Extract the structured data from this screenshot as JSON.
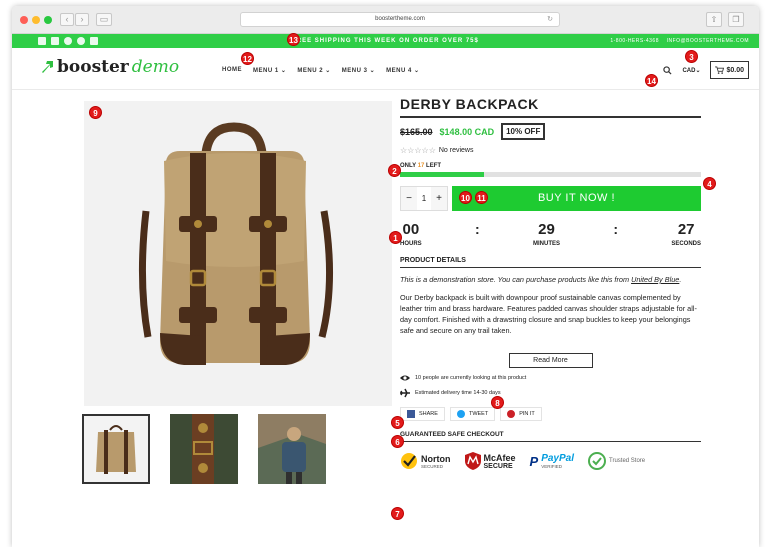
{
  "browser": {
    "url": "boostertheme.com",
    "colors": {
      "close": "#fe5f57",
      "minimize": "#febc2e",
      "zoom": "#28c840"
    }
  },
  "promo_bar": {
    "text": "FREE SHIPPING THIS WEEK ON ORDER OVER 75$",
    "phone": "1-800-HERS-4368",
    "email": "INFO@BOOSTERTHEME.COM",
    "accent": "#2fce47"
  },
  "header": {
    "logo_word1": "booster",
    "logo_word2": "demo",
    "menu": [
      "HOME",
      "MENU 1",
      "MENU 2",
      "MENU 3",
      "MENU 4"
    ],
    "currency": "CAD",
    "cart_total": "$0.00"
  },
  "product": {
    "title": "DERBY BACKPACK",
    "old_price": "$165.00",
    "new_price": "$148.00 CAD",
    "discount": "10% OFF",
    "reviews": "No reviews",
    "stock_prefix": "ONLY",
    "stock_count": "17",
    "stock_suffix": "LEFT",
    "stock_fraction": 0.28,
    "quantity": "1",
    "buy_label": "BUY IT NOW !",
    "countdown": [
      {
        "value": "00",
        "label": "HOURS"
      },
      {
        "value": "29",
        "label": "MINUTES"
      },
      {
        "value": "27",
        "label": "SECONDS"
      }
    ],
    "details_heading": "PRODUCT DETAILS",
    "demo_note": "This is a demonstration store. You can purchase products like this from",
    "demo_link": "United By Blue",
    "description": "Our Derby backpack is built with downpour proof sustainable canvas complemented by leather trim and brass hardware. Features padded canvas shoulder straps adjustable for all-day comfort. Finished with a drawstring closure and snap buckles to keep your belongings safe and secure on any trail taken.",
    "read_more": "Read More",
    "viewers": "10 people are currently looking at this product",
    "delivery": "Estimated delivery time 14-30 days",
    "share": [
      "SHARE",
      "TWEET",
      "PIN IT"
    ],
    "safe_heading": "GUARANTEED SAFE CHECKOUT",
    "trust": {
      "norton": "Norton",
      "norton_sub": "SECURED",
      "mcafee": "McAfee",
      "mcafee_sub": "SECURE",
      "paypal": "PayPal",
      "paypal_sub": "VERIFIED",
      "trusted": "Trusted Store"
    }
  },
  "badges": [
    "1",
    "2",
    "3",
    "4",
    "5",
    "6",
    "7",
    "8",
    "9",
    "10",
    "11",
    "12",
    "13",
    "14"
  ]
}
